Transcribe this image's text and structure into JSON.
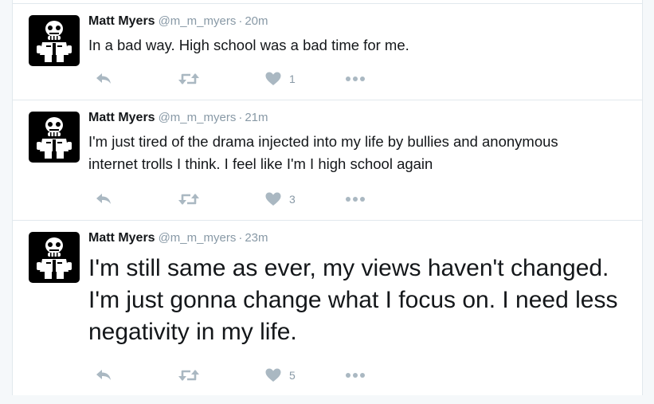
{
  "colors": {
    "icon": "#aab8c2",
    "meta": "#8899a6",
    "text": "#14171a",
    "divider": "#e1e8ed"
  },
  "tweets": [
    {
      "name": "Matt Myers",
      "handle": "@m_m_myers",
      "separator": "·",
      "time": "20m",
      "text": "In a bad way. High school was a bad time for me.",
      "likes": "1",
      "icons": [
        "reply-icon",
        "retweet-icon",
        "heart-icon",
        "more-icon"
      ]
    },
    {
      "name": "Matt Myers",
      "handle": "@m_m_myers",
      "separator": "·",
      "time": "21m",
      "text": "I'm just tired of the drama injected into my life by bullies and anonymous internet trolls I think. I feel like I'm I high school again",
      "likes": "3",
      "icons": [
        "reply-icon",
        "retweet-icon",
        "heart-icon",
        "more-icon"
      ]
    },
    {
      "name": "Matt Myers",
      "handle": "@m_m_myers",
      "separator": "·",
      "time": "23m",
      "text": "I'm still same as ever, my views haven't changed. I'm just gonna change what I focus on. I need less negativity in my life.",
      "likes": "5",
      "icons": [
        "reply-icon",
        "retweet-icon",
        "heart-icon",
        "more-icon"
      ]
    }
  ]
}
